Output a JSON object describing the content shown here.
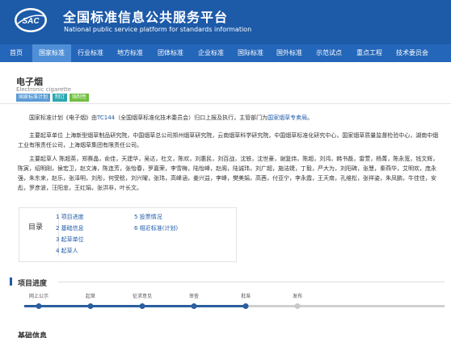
{
  "header": {
    "logo_text": "SAC",
    "title": "全国标准信息公共服务平台",
    "subtitle": "National public service platform  for standards information",
    "brand_color": "#1d5aa8"
  },
  "nav": {
    "active_index": 1,
    "items": [
      "首页",
      "国家标准",
      "行业标准",
      "地方标准",
      "团体标准",
      "企业标准",
      "国际标准",
      "国外标准",
      "示范试点",
      "重点工程",
      "技术委员会"
    ]
  },
  "product": {
    "title": "电子烟",
    "english_title": "Electronic cigarette",
    "tags": [
      {
        "label": "国家标准计划",
        "color": "#5b9bd5"
      },
      {
        "label": "制订",
        "color": "#2aa8b0"
      },
      {
        "label": "强制性",
        "color": "#6fbf3f"
      }
    ]
  },
  "paragraphs": {
    "intro_prefix": "国家标准计划《电子烟》由",
    "intro_tc": "TC144",
    "intro_mid": "（全国烟草标准化技术委员会）归口上报及执行，主管部门为",
    "intro_dept": "国家烟草专卖局",
    "intro_end": "。",
    "drafting_units": "主要起草单位 上海新型烟草制品研究院，中国烟草总公司郑州烟草研究院，云南烟草科学研究院，中国烟草标准化研究中心，国家烟草质量监督检验中心，湖南中烟工业有限责任公司，上海烟草集团有限责任公司。",
    "drafters": "主要起草人 陈超英，郑赛晶，俞佳，天建华，吴达，杜文，陈欢，刘惠民，刘百战，沈轶，沈世豪，谢复炜，陈超，刘鸿，韩书磊，雷萱，杨菁，陈永宽，钱文辉，陈寅，绍明刚，侯宏卫，赵文涛，陈连芳，张怡春，罗嘉荣，李雪梅，陆怡峰，赵阁，陆诚玮，刘广超，施洁婕，丁毅，严大为，刘阳碑，张慧，秦燕华，艾明欢，庞永强，朱东来，赵乐，张泽明，刘彤，何受稔，刘兴曜，张玮，高峰涵，姜兴益，李峰，樊美娟，高茜，付亚宁，李永霞，王天南，孔维松，张祥姿，朱凤鹏，牛佳佳，安彪，罗彦波，汪阳忠，王红娟，张洪非，叶长文。"
  },
  "toc": {
    "title": "目录",
    "items": [
      "1  项目进度",
      "2  基础信息",
      "3  起草单位",
      "4  起草人",
      "5  投票情况",
      "6  相近标准(计划)"
    ]
  },
  "progress": {
    "section_title": "项目进度",
    "completed_steps": 5,
    "steps": [
      "网上公示",
      "起草",
      "征求意见",
      "审查",
      "批准",
      "发布"
    ]
  },
  "next_section_title": "基础信息"
}
